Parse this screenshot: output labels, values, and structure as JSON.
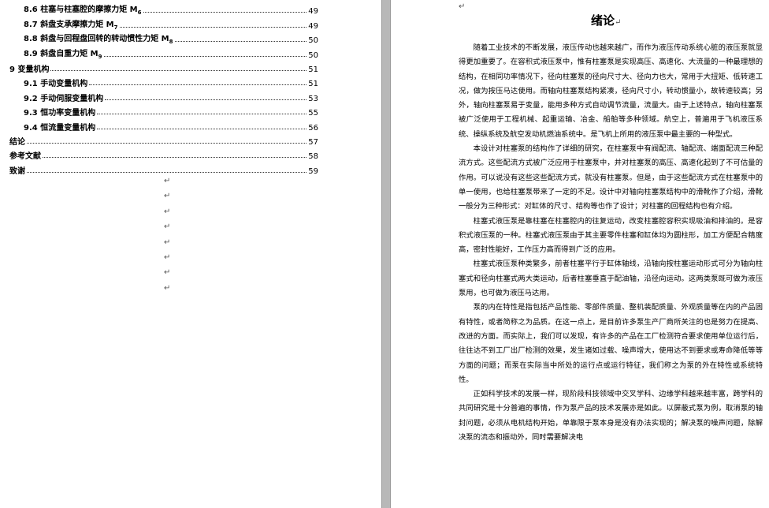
{
  "toc": [
    {
      "level": 2,
      "label": "8.6 柱塞与柱塞腔的摩擦力矩 M",
      "sub": "6",
      "page": "49"
    },
    {
      "level": 2,
      "label": "8.7 斜盘支承摩擦力矩 M",
      "sub": "7",
      "page": "49"
    },
    {
      "level": 2,
      "label": "8.8 斜盘与回程盘回转的转动惯性力矩 M",
      "sub": "8",
      "page": "50"
    },
    {
      "level": 2,
      "label": "8.9 斜盘自重力矩 M",
      "sub": "9",
      "page": "50"
    },
    {
      "level": 1,
      "label": "9  变量机构",
      "sub": "",
      "page": "51"
    },
    {
      "level": 2,
      "label": "9.1 手动变量机构",
      "sub": "",
      "page": "51"
    },
    {
      "level": 2,
      "label": "9.2 手动伺服变量机构",
      "sub": "",
      "page": "53"
    },
    {
      "level": 2,
      "label": "9.3 恒功率变量机构",
      "sub": "",
      "page": "55"
    },
    {
      "level": 2,
      "label": "9.4 恒流量变量机构",
      "sub": "",
      "page": "56"
    },
    {
      "level": 1,
      "label": "结论",
      "sub": "",
      "page": "57"
    },
    {
      "level": 1,
      "label": "参考文献",
      "sub": "",
      "page": "58"
    },
    {
      "level": 1,
      "label": "致谢",
      "sub": "",
      "page": "59"
    }
  ],
  "paragraph_mark": "↵",
  "right_page": {
    "title": "绪论",
    "paragraphs": [
      "随着工业技术的不断发展，液压传动也越来越广，而作为液压传动系统心脏的液压泵就显得更加重要了。在容积式液压泵中，惟有柱塞泵是实现高压、高速化、大流量的一种最理想的结构，在相同功率情况下，径向柱塞泵的径向尺寸大、径向力也大，常用于大扭矩、低转速工况，做为按压马达使用。而轴向柱塞泵结构紧凑，径向尺寸小，转动惯量小，故转速较高；另外，轴向柱塞泵易于变量，能用多种方式自动调节流量，流量大。由于上述特点，轴向柱塞泵被广泛使用于工程机械、起重运输、冶金、船舶等多种领域。航空上，普遍用于飞机液压系统、操纵系统及航空发动机燃油系统中。是飞机上所用的液压泵中最主要的一种型式。",
      "本设计对柱塞泵的结构作了详细的研究，在柱塞泵中有阀配流、轴配流、端面配流三种配流方式。这些配流方式被广泛应用于柱塞泵中，并对柱塞泵的高压、高速化起到了不可估量的作用。可以说没有这些这些配流方式，就没有柱塞泵。但是，由于这些配流方式在柱塞泵中的单一使用，也给柱塞泵带来了一定的不足。设计中对轴向柱塞泵结构中的滑靴作了介绍，滑靴一般分为三种形式：对缸体的尺寸、结构等也作了设计；对柱塞的回程结构也有介绍。",
      "柱塞式液压泵是靠柱塞在柱塞腔内的往复运动，改变柱塞腔容积实现吸油和排油的。是容积式液压泵的一种。柱塞式液压泵由于其主要零件柱塞和缸体均为圆柱形，加工方便配合精度高，密封性能好，工作压力高而得到广泛的应用。",
      "柱塞式液压泵种类繁多，前者柱塞平行于缸体轴线，沿轴向按柱塞运动形式可分为轴向柱塞式和径向柱塞式两大类运动，后者柱塞垂直于配油轴，沿径向运动。这两类泵既可做为液压泵用，也可做为液压马达用。",
      "泵的内在特性是指包括产品性能、零部件质量、整机装配质量、外观质量等在内的产品固有特性，或者简称之为品质。在这一点上，是目前许多泵生产厂商所关注的也是努力在提高、改进的方面。而实际上，我们可以发现，有许多的产品在工厂检测符合要求使用单位运行后，往往达不到工厂出厂检测的效果，发生诸如过载、噪声增大，使用达不到要求或寿命降低等等方面的问题；而泵在实际当中所处的运行点或运行特征，我们称之为泵的外在特性或系统特性。",
      "正如科学技术的发展一样，现阶段科技领域中交叉学科、边缘学科越来越丰富，跨学科的共同研究是十分普遍的事情，作为泵产品的技术发展亦是如此。以屏蔽式泵为例，取消泵的轴封问题，必须从电机结构开始，单靠限于泵本身是没有办法实现的；解决泵的噪声问题，除解决泵的流态和振动外，同时需要解决电"
    ]
  }
}
